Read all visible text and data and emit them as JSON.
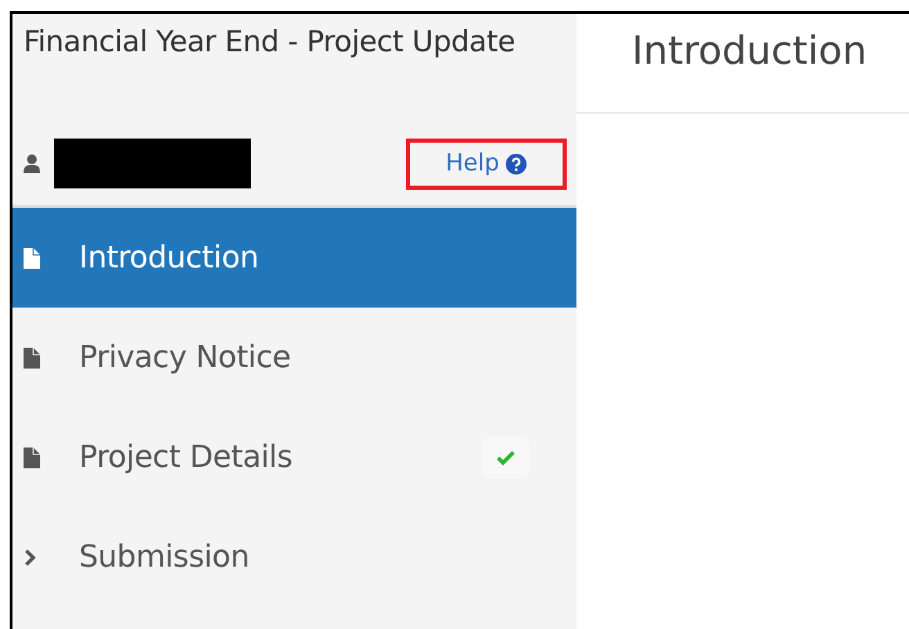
{
  "sidebar": {
    "title": "Financial Year End - Project Update",
    "help": {
      "label": "Help",
      "highlighted": true
    },
    "items": [
      {
        "label": "Introduction",
        "kind": "page",
        "selected": true,
        "completed": false
      },
      {
        "label": "Privacy Notice",
        "kind": "page",
        "selected": false,
        "completed": false
      },
      {
        "label": "Project Details",
        "kind": "page",
        "selected": false,
        "completed": true
      },
      {
        "label": "Submission",
        "kind": "section",
        "selected": false,
        "completed": false
      }
    ]
  },
  "main": {
    "heading": "Introduction"
  }
}
